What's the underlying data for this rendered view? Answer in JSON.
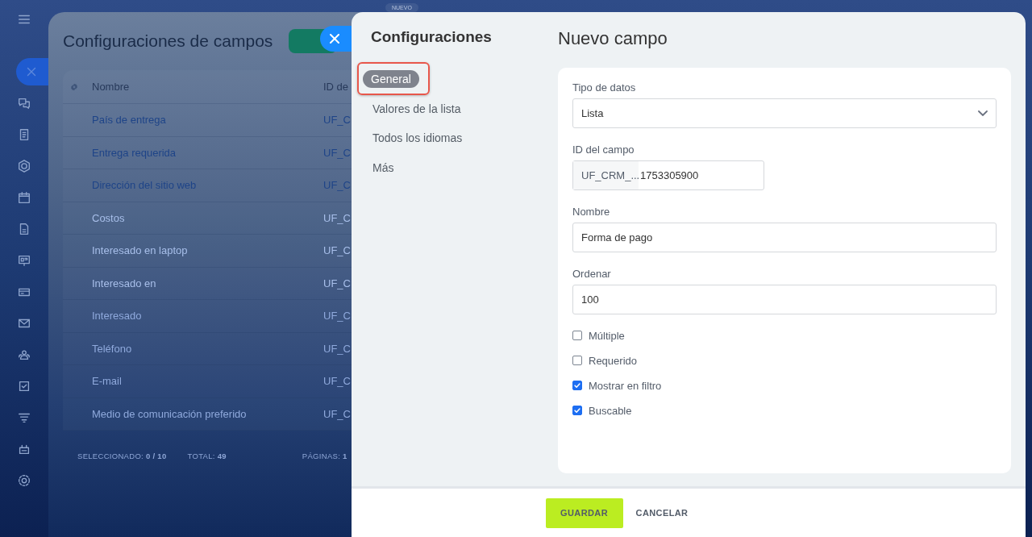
{
  "background_page": {
    "badge": "NUEVO",
    "title": "Configuraciones de campos",
    "table": {
      "columns": [
        "Nombre",
        "ID de"
      ],
      "rows": [
        {
          "name": "País de entrega",
          "id": "UF_C"
        },
        {
          "name": "Entrega requerida",
          "id": "UF_C"
        },
        {
          "name": "Dirección del sitio web",
          "id": "UF_C"
        },
        {
          "name": "Costos",
          "id": "UF_C"
        },
        {
          "name": "Interesado en laptop",
          "id": "UF_C"
        },
        {
          "name": "Interesado en",
          "id": "UF_C"
        },
        {
          "name": "Interesado",
          "id": "UF_C"
        },
        {
          "name": "Teléfono",
          "id": "UF_C"
        },
        {
          "name": "E-mail",
          "id": "UF_C"
        },
        {
          "name": "Medio de comunicación preferido",
          "id": "UF_C"
        }
      ]
    },
    "footer": [
      {
        "label": "SELECCIONADO:",
        "value": "0 / 10"
      },
      {
        "label": "TOTAL:",
        "value": "49"
      },
      {
        "label": "PÁGINAS:",
        "value": "1"
      }
    ]
  },
  "slider": {
    "sidebar": {
      "title": "Configuraciones",
      "items": [
        {
          "label": "General",
          "selected": true,
          "highlighted": true
        },
        {
          "label": "Valores de la lista",
          "selected": false,
          "highlighted": false
        },
        {
          "label": "Todos los idiomas",
          "selected": false,
          "highlighted": false
        },
        {
          "label": "Más",
          "selected": false,
          "highlighted": false
        }
      ]
    },
    "title": "Nuevo campo",
    "fields": [
      {
        "kind": "select",
        "label": "Tipo de datos",
        "value": "Lista"
      },
      {
        "kind": "id",
        "label": "ID del campo",
        "prefix": "UF_CRM_...",
        "value": "1753305900"
      },
      {
        "kind": "text",
        "label": "Nombre",
        "value": "Forma de pago"
      },
      {
        "kind": "text",
        "label": "Ordenar",
        "value": "100"
      }
    ],
    "checkboxes": [
      {
        "label": "Múltiple",
        "checked": false
      },
      {
        "label": "Requerido",
        "checked": false
      },
      {
        "label": "Mostrar en filtro",
        "checked": true
      },
      {
        "label": "Buscable",
        "checked": true
      }
    ],
    "buttons": [
      {
        "kind": "primary",
        "label": "GUARDAR"
      },
      {
        "kind": "link",
        "label": "CANCELAR"
      }
    ]
  }
}
